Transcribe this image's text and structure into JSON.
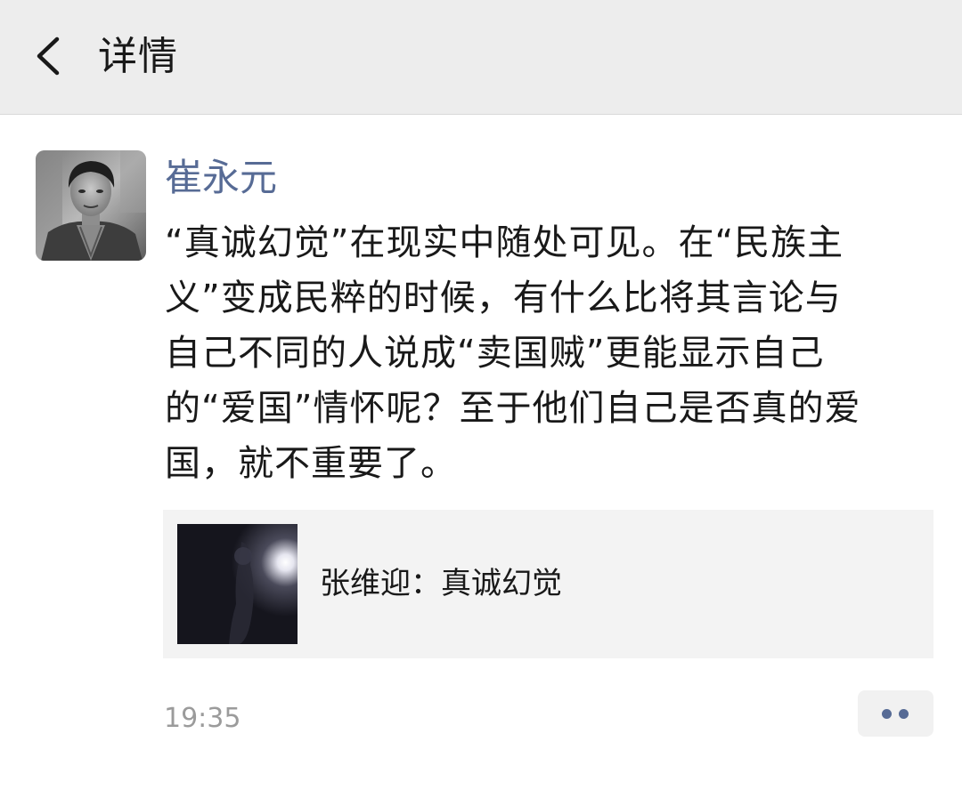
{
  "nav": {
    "back_icon": "chevron-left-icon",
    "title": "详情"
  },
  "post": {
    "author": "崔永元",
    "avatar_icon": "avatar",
    "text": "“真诚幻觉”在现实中随处可见。在“民族主\n义”变成民粹的时候，有什么比将其言论与\n自己不同的人说成“卖国贼”更能显示自己\n的“爱国”情怀呢？至于他们自己是否真的爱\n国，就不重要了。",
    "share": {
      "title": "张维迎：真诚幻觉"
    },
    "time": "19:35",
    "more_icon": "more-dots-icon"
  },
  "colors": {
    "nav_bg": "#ededed",
    "link_blue": "#576b95",
    "text": "#191919",
    "muted": "#9b9b9b",
    "card_bg": "#f3f3f3"
  }
}
